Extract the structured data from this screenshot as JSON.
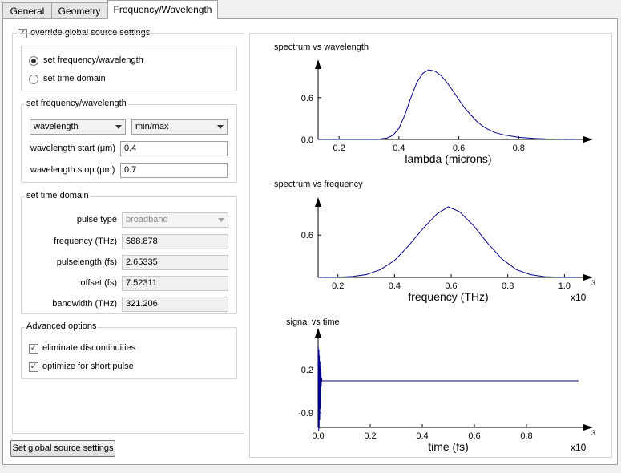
{
  "tabs": [
    {
      "label": "General"
    },
    {
      "label": "Geometry"
    },
    {
      "label": "Frequency/Wavelength"
    }
  ],
  "override": {
    "label": "override global source settings",
    "checked": true
  },
  "mode": {
    "options": [
      {
        "label": "set frequency/wavelength",
        "selected": true
      },
      {
        "label": "set time domain",
        "selected": false
      }
    ]
  },
  "freq_group": {
    "title": "set frequency/wavelength",
    "type_select": "wavelength",
    "range_select": "min/max",
    "start_label": "wavelength start (μm)",
    "start_value": "0.4",
    "stop_label": "wavelength stop (μm)",
    "stop_value": "0.7"
  },
  "time_group": {
    "title": "set time domain",
    "pulse_type_label": "pulse type",
    "pulse_type_value": "broadband",
    "fields": [
      {
        "label": "frequency (THz)",
        "value": "588.878"
      },
      {
        "label": "pulselength (fs)",
        "value": "2.65335"
      },
      {
        "label": "offset (fs)",
        "value": "7.52311"
      },
      {
        "label": "bandwidth (THz)",
        "value": "321.206"
      }
    ]
  },
  "advanced": {
    "title": "Advanced options",
    "options": [
      {
        "label": "eliminate discontinuities",
        "checked": true
      },
      {
        "label": "optimize for short pulse",
        "checked": true
      }
    ]
  },
  "global_button": "Set global source settings",
  "colors": {
    "curve": "#00008b",
    "axis": "#000000"
  },
  "chart_data": [
    {
      "type": "line",
      "title": "spectrum vs wavelength",
      "xlabel": "lambda (microns)",
      "ylabel": "",
      "x_exponent": "",
      "xlim": [
        0.13,
        1.0
      ],
      "ylim": [
        0,
        1.0
      ],
      "xticks": [
        "0.2",
        "0.4",
        "0.6",
        "0.8"
      ],
      "yticks": [
        "0.0",
        "0.6"
      ],
      "x": [
        0.13,
        0.2,
        0.3,
        0.33,
        0.36,
        0.38,
        0.4,
        0.42,
        0.44,
        0.46,
        0.48,
        0.5,
        0.52,
        0.54,
        0.56,
        0.58,
        0.6,
        0.62,
        0.64,
        0.66,
        0.68,
        0.7,
        0.72,
        0.75,
        0.8,
        0.85,
        0.9,
        0.95,
        1.0
      ],
      "y": [
        0,
        0,
        0,
        0.002,
        0.02,
        0.06,
        0.16,
        0.35,
        0.6,
        0.82,
        0.95,
        1.0,
        0.98,
        0.92,
        0.82,
        0.7,
        0.57,
        0.45,
        0.35,
        0.26,
        0.19,
        0.14,
        0.1,
        0.065,
        0.03,
        0.014,
        0.006,
        0.002,
        0
      ]
    },
    {
      "type": "line",
      "title": "spectrum vs frequency",
      "xlabel": "frequency (THz)",
      "ylabel": "",
      "x_exponent": "x10",
      "x_exponent_power": "3",
      "xlim": [
        0.13,
        1.05
      ],
      "ylim": [
        0,
        1.0
      ],
      "xticks": [
        "0.2",
        "0.4",
        "0.6",
        "0.8",
        "1.0"
      ],
      "yticks": [
        "0.6"
      ],
      "x": [
        0.13,
        0.2,
        0.25,
        0.3,
        0.35,
        0.4,
        0.45,
        0.5,
        0.55,
        0.59,
        0.63,
        0.68,
        0.73,
        0.78,
        0.83,
        0.88,
        0.93,
        1.0,
        1.05
      ],
      "y": [
        0,
        0.003,
        0.012,
        0.04,
        0.11,
        0.24,
        0.45,
        0.69,
        0.9,
        1.0,
        0.93,
        0.73,
        0.48,
        0.26,
        0.11,
        0.04,
        0.01,
        0.001,
        0
      ]
    },
    {
      "type": "line",
      "title": "signal vs time",
      "xlabel": "time (fs)",
      "ylabel": "",
      "x_exponent": "x10",
      "x_exponent_power": "3",
      "xlim": [
        0.0,
        1.0
      ],
      "ylim": [
        -0.9,
        0.6
      ],
      "xticks": [
        "0.0",
        "0.2",
        "0.4",
        "0.6",
        "0.8"
      ],
      "yticks": [
        "0.2",
        "-0.9"
      ],
      "x": [
        0,
        0.001,
        0.002,
        0.003,
        0.004,
        0.005,
        0.006,
        0.007,
        0.008,
        0.009,
        0.01,
        0.011,
        0.012,
        0.013,
        0.015,
        0.02,
        0.2,
        0.4,
        0.6,
        0.8,
        1.0
      ],
      "y": [
        0,
        0.6,
        -0.9,
        0.55,
        -0.85,
        0.45,
        -0.7,
        0.35,
        -0.5,
        0.25,
        -0.3,
        0.15,
        -0.1,
        0.05,
        0,
        0,
        0,
        0,
        0,
        0,
        0
      ]
    }
  ]
}
